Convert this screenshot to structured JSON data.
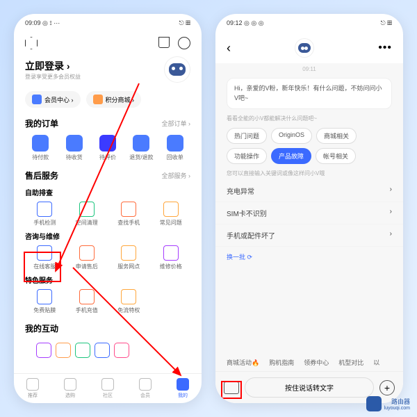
{
  "p1": {
    "status_time": "09:09",
    "status_icons": "◎ ⟟ ⋯",
    "status_right": "⎋ ▦",
    "login_title": "立即登录 ›",
    "login_sub": "登录享受更多会员权益",
    "pills": {
      "member": "会员中心 ›",
      "mall": "积分商城 ›"
    },
    "orders": {
      "title": "我的订单",
      "more": "全部订单 ›",
      "items": [
        {
          "label": "待付款",
          "color": "#4a7bff"
        },
        {
          "label": "待收货",
          "color": "#4a7bff"
        },
        {
          "label": "待评价",
          "color": "#3b3bff"
        },
        {
          "label": "退货/退款",
          "color": "#4a7bff"
        },
        {
          "label": "回收单",
          "color": "#4a7bff"
        }
      ]
    },
    "after": {
      "title": "售后服务",
      "more": "全部服务 ›",
      "self_title": "自助排查",
      "self": [
        {
          "label": "手机检测",
          "color": "#3b6aff"
        },
        {
          "label": "空间清理",
          "color": "#1bc47d"
        },
        {
          "label": "查找手机",
          "color": "#ff6b3b"
        },
        {
          "label": "常见问题",
          "color": "#ffa63b"
        }
      ],
      "consult_title": "咨询与维修",
      "consult": [
        {
          "label": "在线客服",
          "color": "#3b6aff"
        },
        {
          "label": "申请售后",
          "color": "#ff6b3b"
        },
        {
          "label": "服务网点",
          "color": "#ffa63b"
        },
        {
          "label": "维修价格",
          "color": "#a53bff"
        }
      ],
      "special_title": "特色服务",
      "special": [
        {
          "label": "免费贴膜",
          "color": "#3b6aff"
        },
        {
          "label": "手机充值",
          "color": "#ff6b3b"
        },
        {
          "label": "免流特权",
          "color": "#ffa63b"
        }
      ]
    },
    "interact": {
      "title": "我的互动",
      "colors": [
        "#a53bff",
        "#ff9c4a",
        "#1bc47d",
        "#3b6aff",
        "#ff4a8a"
      ]
    },
    "tabs": [
      {
        "label": "推荐"
      },
      {
        "label": "选购"
      },
      {
        "label": "社区"
      },
      {
        "label": "会员"
      },
      {
        "label": "我的"
      }
    ]
  },
  "p2": {
    "status_time": "09:12",
    "time_chip": "09:11",
    "greeting": "Hi，亲爱的V粉，新年快乐！有什么问题，不妨问问小V吧~",
    "hint1": "看看全能的小V都能解决什么问题吧~",
    "chips": [
      "热门问题",
      "OriginOS",
      "商城相关",
      "功能操作",
      "产品故障",
      "帐号相关"
    ],
    "hint2": "您可以直接输入关键词或像这样问小V哦",
    "qs": [
      "充电异常",
      "SIM卡不识别",
      "手机或配件坏了"
    ],
    "refresh": "换一批 ⟳",
    "suggest": [
      "商城活动🔥",
      "购机指南",
      "领券中心",
      "机型对比",
      "以"
    ],
    "voice": "按住说话转文字"
  },
  "watermark": {
    "name": "路由器",
    "url": "luyouqi.com"
  }
}
